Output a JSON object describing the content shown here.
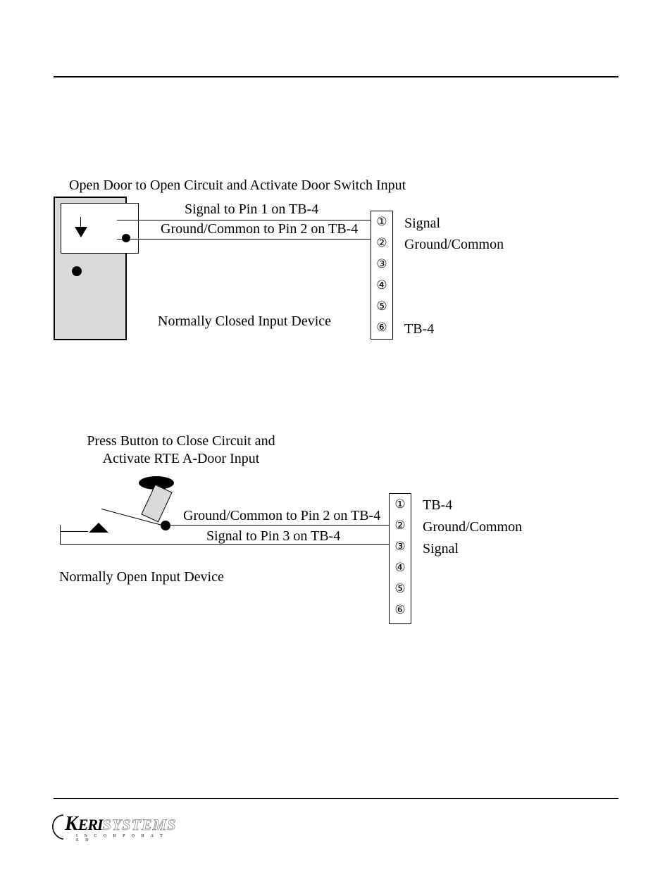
{
  "figure1": {
    "caption": "Open Door to Open Circuit and Activate Door Switch Input",
    "wire_top_label": "Signal to Pin 1 on TB-4",
    "wire_bottom_label": "Ground/Common to Pin 2 on TB-4",
    "device_label": "Normally Closed Input Device",
    "right_label_signal": "Signal",
    "right_label_ground": "Ground/Common",
    "right_label_tb": "TB-4"
  },
  "figure2": {
    "caption_line1": "Press Button to Close Circuit and",
    "caption_line2": "Activate RTE A-Door Input",
    "wire_top_label": "Ground/Common to Pin 2 on TB-4",
    "wire_bottom_label": "Signal to Pin 3 on TB-4",
    "device_label": "Normally Open Input Device",
    "right_label_tb": "TB-4",
    "right_label_ground": "Ground/Common",
    "right_label_signal": "Signal"
  },
  "tb_pins": {
    "p1": "①",
    "p2": "②",
    "p3": "③",
    "p4": "④",
    "p5": "⑤",
    "p6": "⑥"
  },
  "footer": {
    "logo_brand": "KERI",
    "logo_systems": "SYSTEMS",
    "logo_inc": "I N C O R P O R A T E D"
  }
}
